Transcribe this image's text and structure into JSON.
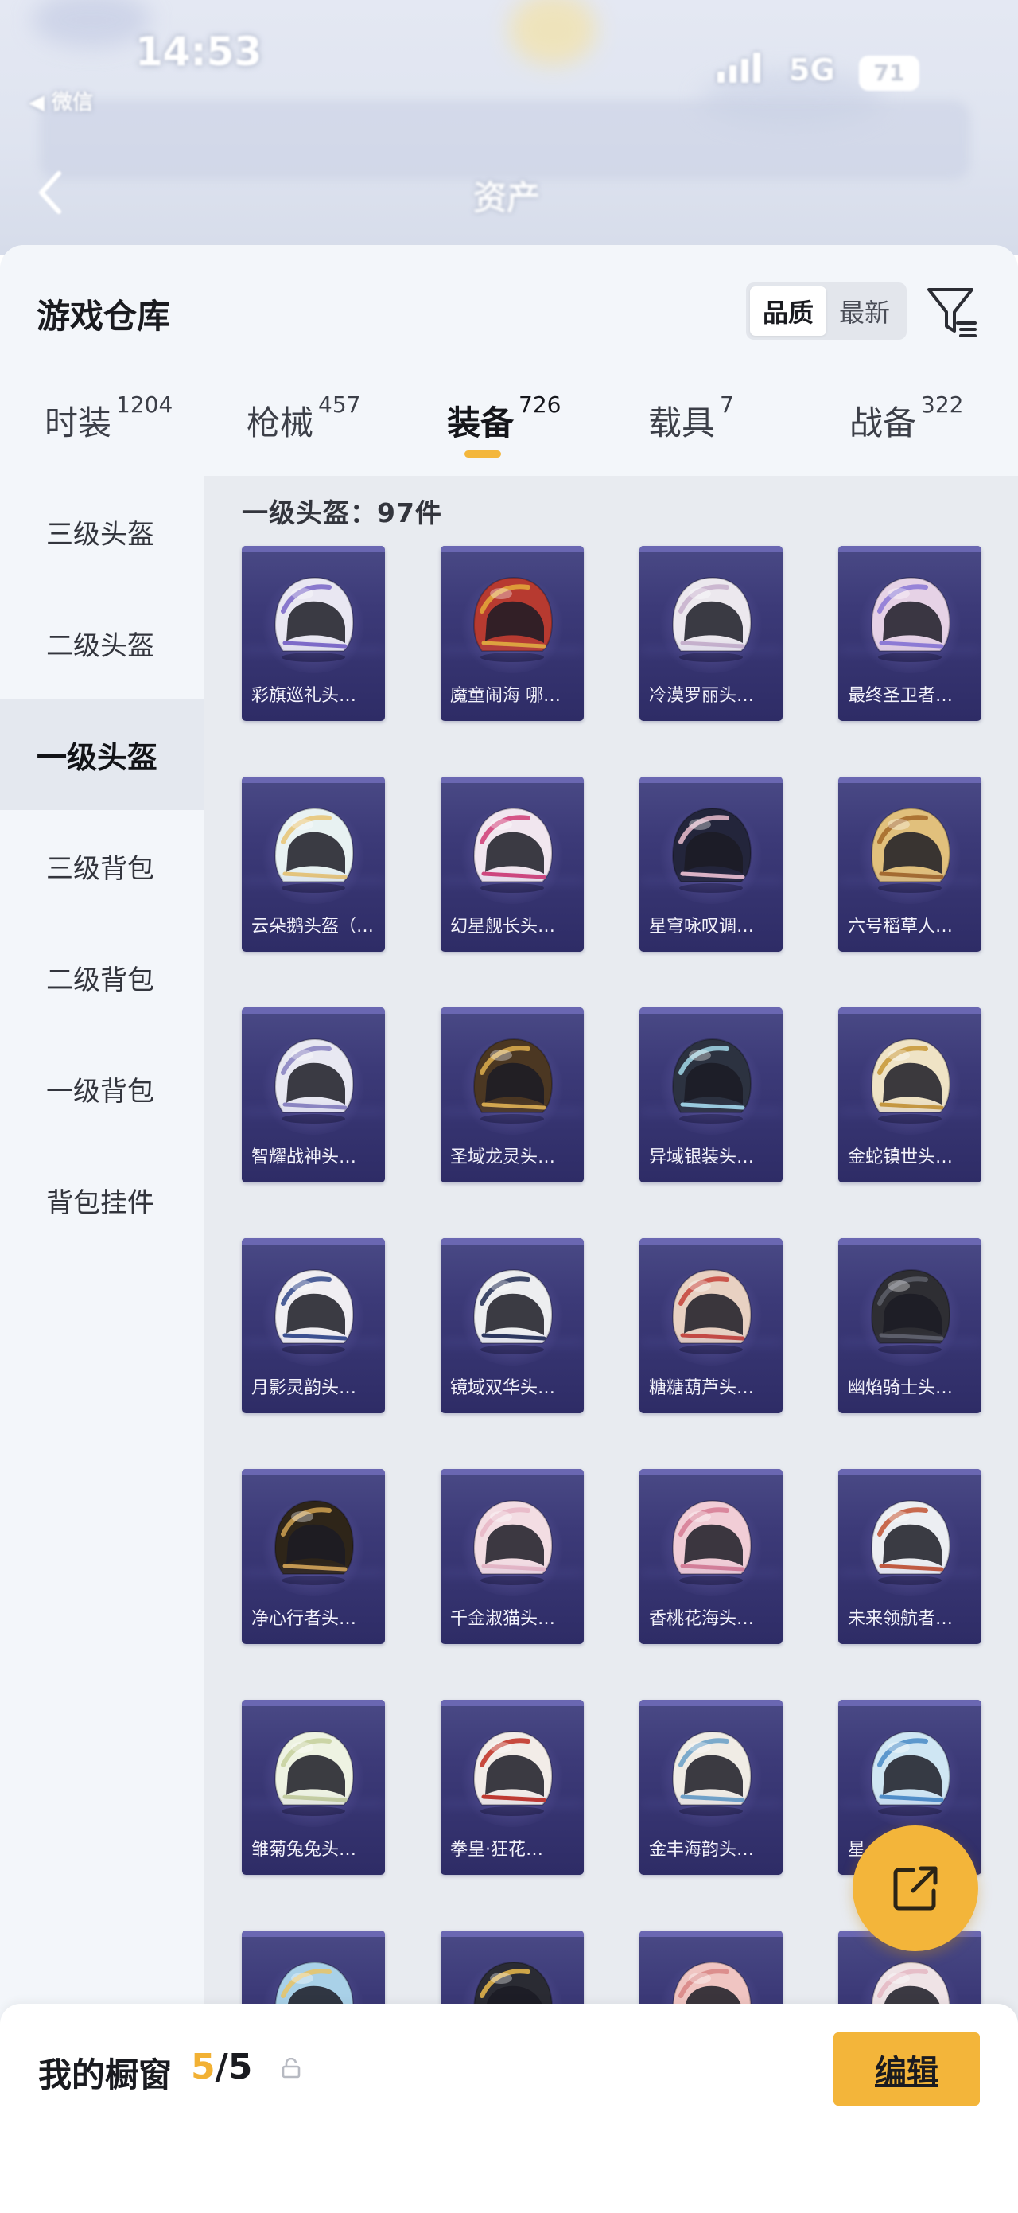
{
  "status_bar": {
    "time": "14:53",
    "back_app": "◀ 微信",
    "network": "5G",
    "battery": "71"
  },
  "nav": {
    "title": "资产"
  },
  "warehouse": {
    "title": "游戏仓库",
    "sort_options": [
      "品质",
      "最新"
    ],
    "active_sort": "品质",
    "tabs": [
      {
        "label": "时装",
        "count": "1204"
      },
      {
        "label": "枪械",
        "count": "457"
      },
      {
        "label": "装备",
        "count": "726"
      },
      {
        "label": "载具",
        "count": "7"
      },
      {
        "label": "战备",
        "count": "322"
      }
    ],
    "active_tab": "装备"
  },
  "categories": [
    "三级头盔",
    "二级头盔",
    "一级头盔",
    "三级背包",
    "二级背包",
    "一级背包",
    "背包挂件"
  ],
  "active_category": "一级头盔",
  "section_title": "一级头盔：97件",
  "items": [
    {
      "name": "彩旗巡礼头…",
      "color": "#e9e7f2",
      "accent": "#7e6bc9"
    },
    {
      "name": "魔童闹海 哪…",
      "color": "#b73a30",
      "accent": "#e2a53a"
    },
    {
      "name": "冷漠罗丽头…",
      "color": "#ece8ee",
      "accent": "#c9b3cd"
    },
    {
      "name": "最终圣卫者…",
      "color": "#e6d2e6",
      "accent": "#8e7bd6"
    },
    {
      "name": "云朵鹅头盔（…",
      "color": "#e8f2f2",
      "accent": "#e8c77a"
    },
    {
      "name": "幻星舰长头…",
      "color": "#f1e6ef",
      "accent": "#d2447b"
    },
    {
      "name": "星穹咏叹调…",
      "color": "#23253b",
      "accent": "#e0b6c6"
    },
    {
      "name": "六号稻草人…",
      "color": "#e1c07c",
      "accent": "#a66b2c"
    },
    {
      "name": "智耀战神头…",
      "color": "#e8e8f2",
      "accent": "#8c86c2"
    },
    {
      "name": "圣域龙灵头…",
      "color": "#4b3722",
      "accent": "#d7a94b"
    },
    {
      "name": "异域银装头…",
      "color": "#2c3240",
      "accent": "#9ccfe0"
    },
    {
      "name": "金蛇镇世头…",
      "color": "#efe3c5",
      "accent": "#c99a3c"
    },
    {
      "name": "月影灵韵头…",
      "color": "#f0eef2",
      "accent": "#3a4f8e"
    },
    {
      "name": "镜域双华头…",
      "color": "#edeef0",
      "accent": "#2a355a"
    },
    {
      "name": "糖糖葫芦头…",
      "color": "#e8d1c2",
      "accent": "#c7483f"
    },
    {
      "name": "幽焰骑士头…",
      "color": "#2e2e33",
      "accent": "#5b5d66"
    },
    {
      "name": "净心行者头…",
      "color": "#2e2519",
      "accent": "#c89b4e"
    },
    {
      "name": "千金淑猫头…",
      "color": "#f3dde3",
      "accent": "#e8b8c6"
    },
    {
      "name": "香桃花海头…",
      "color": "#f1cdd6",
      "accent": "#d77f97"
    },
    {
      "name": "未来领航者…",
      "color": "#eceef2",
      "accent": "#c45a3c"
    },
    {
      "name": "雏菊兔兔头…",
      "color": "#eef3e2",
      "accent": "#c7d1a0"
    },
    {
      "name": "拳皇·狂花…",
      "color": "#f2ece8",
      "accent": "#c2372b"
    },
    {
      "name": "金丰海韵头…",
      "color": "#f0ece5",
      "accent": "#6fa3c8"
    },
    {
      "name": "星…",
      "color": "#cfe6f3",
      "accent": "#4f8fc9"
    },
    {
      "name": "",
      "color": "#a9d1e8",
      "accent": "#e6c46b"
    },
    {
      "name": "",
      "color": "#2a2b33",
      "accent": "#e0b24a"
    },
    {
      "name": "",
      "color": "#f0c5c2",
      "accent": "#d98787"
    },
    {
      "name": "",
      "color": "#efe3e6",
      "accent": "#e4b9c4"
    }
  ],
  "showcase": {
    "label": "我的橱窗",
    "current": "5",
    "total": "/5",
    "edit_label": "编辑"
  }
}
